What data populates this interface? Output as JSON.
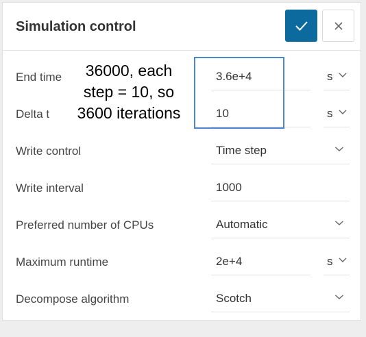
{
  "dialog": {
    "title": "Simulation control",
    "confirm_icon": "check-icon",
    "close_icon": "close-icon",
    "accent_color": "#0d6a9f"
  },
  "fields": {
    "end_time": {
      "label": "End time",
      "value": "3.6e+4",
      "unit": "s"
    },
    "delta_t": {
      "label": "Delta t",
      "value": "10",
      "unit": "s"
    },
    "write_control": {
      "label": "Write control",
      "value": "Time step"
    },
    "write_interval": {
      "label": "Write interval",
      "value": "1000"
    },
    "cpus": {
      "label": "Preferred number of CPUs",
      "value": "Automatic"
    },
    "max_runtime": {
      "label": "Maximum runtime",
      "value": "2e+4",
      "unit": "s"
    },
    "decompose": {
      "label": "Decompose algorithm",
      "value": "Scotch"
    }
  },
  "annotation": {
    "text": "36000, each\nstep = 10, so\n3600 iterations",
    "box_color": "#4a86d0"
  }
}
